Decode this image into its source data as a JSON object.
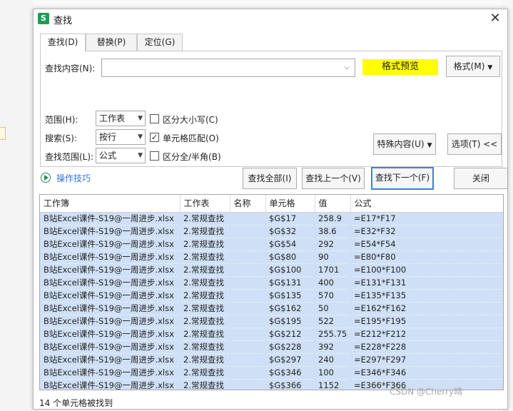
{
  "window": {
    "title": "查找",
    "app_icon": "S",
    "close_glyph": "✕"
  },
  "tabs": [
    {
      "label": "查找(D)",
      "active": true
    },
    {
      "label": "替换(P)",
      "active": false
    },
    {
      "label": "定位(G)",
      "active": false
    }
  ],
  "find": {
    "label": "查找内容(N):",
    "value": "",
    "format_preview": "格式预览",
    "format_button": "格式(M)"
  },
  "options": {
    "range_label": "范围(H):",
    "range_value": "工作表",
    "search_label": "搜索(S):",
    "search_value": "按行",
    "scope_label": "查找范围(L):",
    "scope_value": "公式",
    "case_label": "区分大小写(C)",
    "case_checked": false,
    "cell_match_label": "单元格匹配(O)",
    "cell_match_checked": true,
    "width_label": "区分全/半角(B)",
    "width_checked": false,
    "special_button": "特殊内容(U)",
    "options_button": "选项(T) <<"
  },
  "actions": {
    "tips": "操作技巧",
    "find_all": "查找全部(I)",
    "find_prev": "查找上一个(V)",
    "find_next": "查找下一个(F)",
    "close": "关闭"
  },
  "results": {
    "columns": [
      "工作簿",
      "工作表",
      "名称",
      "单元格",
      "值",
      "公式"
    ],
    "rows": [
      [
        "B站Excel课件-S19@一周进步.xlsx",
        "2.常规查找",
        "",
        "$G$17",
        "258.9",
        "=E17*F17"
      ],
      [
        "B站Excel课件-S19@一周进步.xlsx",
        "2.常规查找",
        "",
        "$G$32",
        "38.6",
        "=E32*F32"
      ],
      [
        "B站Excel课件-S19@一周进步.xlsx",
        "2.常规查找",
        "",
        "$G$54",
        "292",
        "=E54*F54"
      ],
      [
        "B站Excel课件-S19@一周进步.xlsx",
        "2.常规查找",
        "",
        "$G$80",
        "90",
        "=E80*F80"
      ],
      [
        "B站Excel课件-S19@一周进步.xlsx",
        "2.常规查找",
        "",
        "$G$100",
        "1701",
        "=E100*F100"
      ],
      [
        "B站Excel课件-S19@一周进步.xlsx",
        "2.常规查找",
        "",
        "$G$131",
        "400",
        "=E131*F131"
      ],
      [
        "B站Excel课件-S19@一周进步.xlsx",
        "2.常规查找",
        "",
        "$G$135",
        "570",
        "=E135*F135"
      ],
      [
        "B站Excel课件-S19@一周进步.xlsx",
        "2.常规查找",
        "",
        "$G$162",
        "50",
        "=E162*F162"
      ],
      [
        "B站Excel课件-S19@一周进步.xlsx",
        "2.常规查找",
        "",
        "$G$195",
        "522",
        "=E195*F195"
      ],
      [
        "B站Excel课件-S19@一周进步.xlsx",
        "2.常规查找",
        "",
        "$G$212",
        "255.75",
        "=E212*F212"
      ],
      [
        "B站Excel课件-S19@一周进步.xlsx",
        "2.常规查找",
        "",
        "$G$228",
        "392",
        "=E228*F228"
      ],
      [
        "B站Excel课件-S19@一周进步.xlsx",
        "2.常规查找",
        "",
        "$G$297",
        "240",
        "=E297*F297"
      ],
      [
        "B站Excel课件-S19@一周进步.xlsx",
        "2.常规查找",
        "",
        "$G$346",
        "100",
        "=E346*F346"
      ],
      [
        "B站Excel课件-S19@一周进步.xlsx",
        "2.常规查找",
        "",
        "$G$366",
        "1152",
        "=E366*F366"
      ]
    ]
  },
  "status": "14 个单元格被找到",
  "watermark": "CSDN @Cherry晴",
  "colors": {
    "accent_button_border": "#3f7fd7",
    "preview_bg": "#ffff00",
    "selected_row_bg": "#cfe0f6",
    "tips_link": "#2f74d6"
  }
}
